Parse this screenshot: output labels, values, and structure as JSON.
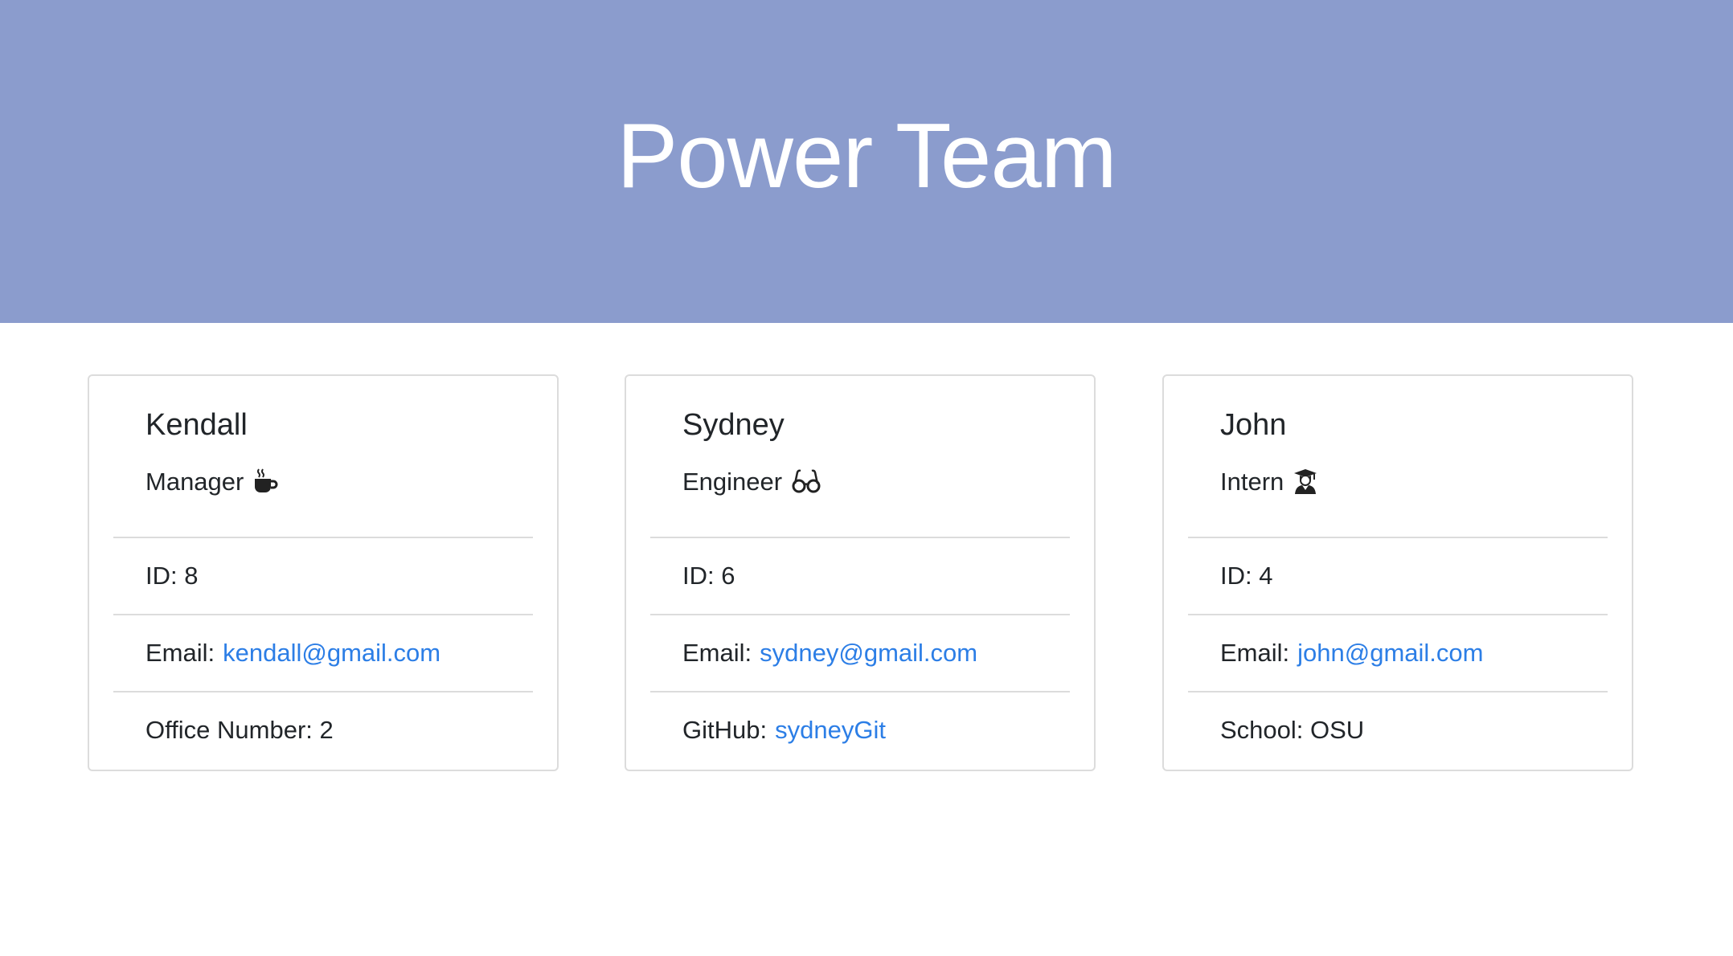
{
  "header": {
    "title": "Power Team",
    "bg_color": "#8b9ccd"
  },
  "cards": [
    {
      "name": "Kendall",
      "role": "Manager",
      "role_icon": "coffee-icon",
      "id_line": "ID: 8",
      "email_label": "Email:",
      "email": "kendall@gmail.com",
      "extra_label": "Office Number: 2",
      "extra_link": ""
    },
    {
      "name": "Sydney",
      "role": "Engineer",
      "role_icon": "glasses-icon",
      "id_line": "ID: 6",
      "email_label": "Email:",
      "email": "sydney@gmail.com",
      "extra_label": "GitHub:",
      "extra_link": "sydneyGit"
    },
    {
      "name": "John",
      "role": "Intern",
      "role_icon": "graduate-icon",
      "id_line": "ID: 4",
      "email_label": "Email:",
      "email": "john@gmail.com",
      "extra_label": "School: OSU",
      "extra_link": ""
    }
  ],
  "colors": {
    "link": "#2c7ee6",
    "text": "#212529",
    "border": "#dcdcdc"
  }
}
